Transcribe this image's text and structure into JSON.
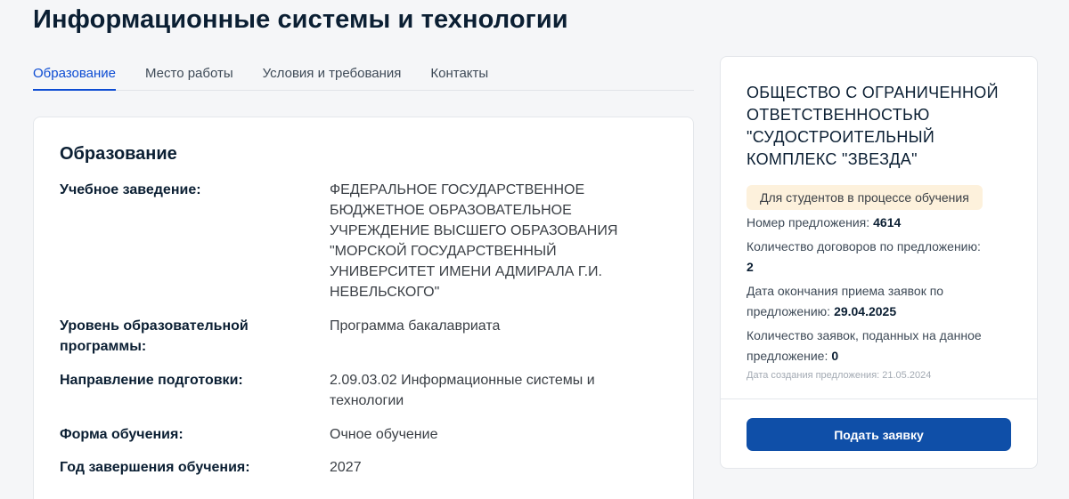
{
  "page": {
    "title": "Информационные системы и технологии"
  },
  "tabs": [
    {
      "label": "Образование"
    },
    {
      "label": "Место работы"
    },
    {
      "label": "Условия и требования"
    },
    {
      "label": "Контакты"
    }
  ],
  "education": {
    "heading": "Образование",
    "rows": [
      {
        "label": "Учебное заведение:",
        "value": "ФЕДЕРАЛЬНОЕ ГОСУДАРСТВЕННОЕ БЮДЖЕТНОЕ ОБРАЗОВАТЕЛЬНОЕ УЧРЕЖДЕНИЕ ВЫСШЕГО ОБРАЗОВАНИЯ \"МОРСКОЙ ГОСУДАРСТВЕННЫЙ УНИВЕРСИТЕТ ИМЕНИ АДМИРАЛА Г.И. НЕВЕЛЬСКОГО\""
      },
      {
        "label": "Уровень образовательной программы:",
        "value": "Программа бакалавриата"
      },
      {
        "label": "Направление подготовки:",
        "value": "2.09.03.02 Информационные системы и технологии"
      },
      {
        "label": "Форма обучения:",
        "value": "Очное обучение"
      },
      {
        "label": "Год завершения обучения:",
        "value": "2027"
      }
    ]
  },
  "offer": {
    "company": "ОБЩЕСТВО С ОГРАНИЧЕННОЙ ОТВЕТСТВЕННОСТЬЮ \"СУДОСТРОИТЕЛЬНЫЙ КОМПЛЕКС \"ЗВЕЗДА\"",
    "badge": "Для студентов в процессе обучения",
    "number_label": "Номер предложения:",
    "number_value": "4614",
    "contracts_label": "Количество договоров по предложению:",
    "contracts_value": "2",
    "deadline_label": "Дата окончания приема заявок по предложению:",
    "deadline_value": "29.04.2025",
    "applications_label": "Количество заявок, поданных на данное предложение:",
    "applications_value": "0",
    "created": "Дата создания предложения: 21.05.2024",
    "apply_button": "Подать заявку"
  },
  "colors": {
    "accent": "#0d4cd3",
    "button": "#0f4fa8",
    "badge_bg": "#fdf1dc"
  }
}
